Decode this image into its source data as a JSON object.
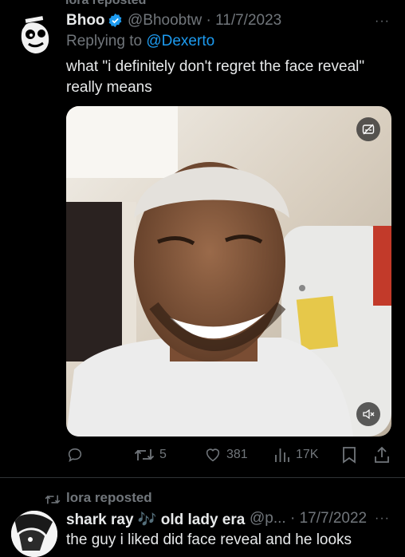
{
  "top_repost": {
    "label": "lora reposted"
  },
  "tweet": {
    "author_name": "Bhoo",
    "handle_date": "@Bhoobtw · 11/7/2023",
    "replying_prefix": "Replying to",
    "replying_to": "@Dexerto",
    "text": "what \"i definitely don't regret the face reveal\" really means",
    "more": "···",
    "media": {
      "type": "video",
      "muted": true
    },
    "actions": {
      "reply_count": "",
      "repost_count": "5",
      "like_count": "381",
      "view_count": "17K"
    }
  },
  "second": {
    "repost_label": "lora reposted",
    "author_name": "shark ray 🎶 old lady era",
    "handle_date": "@p... · 17/7/2022",
    "more": "···",
    "text": "the guy i liked did face reveal and he looks"
  },
  "icons": {
    "verified": "verified-badge-icon",
    "reply": "reply-icon",
    "repost": "repost-icon",
    "like": "heart-icon",
    "views": "views-icon",
    "bookmark": "bookmark-icon",
    "share": "share-icon",
    "mute": "muted-speaker-icon",
    "captions": "captions-icon"
  },
  "colors": {
    "background": "#000000",
    "text": "#e7e9ea",
    "secondary": "#71767b",
    "link": "#1d9bf0"
  }
}
